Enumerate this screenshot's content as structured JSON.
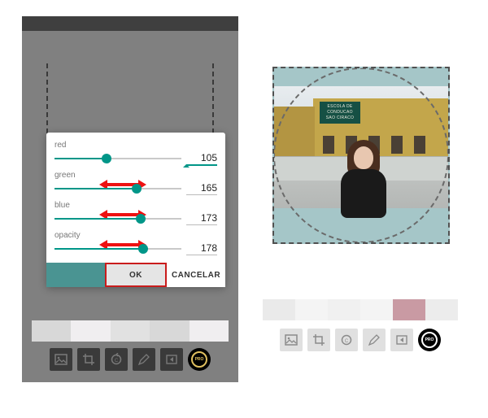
{
  "dialog": {
    "sliders": [
      {
        "label": "red",
        "value": "105",
        "pct": 41
      },
      {
        "label": "green",
        "value": "165",
        "pct": 65
      },
      {
        "label": "blue",
        "value": "173",
        "pct": 68
      },
      {
        "label": "opacity",
        "value": "178",
        "pct": 70
      }
    ],
    "ok_label": "OK",
    "cancel_label": "CANCELAR",
    "swatch_color": "#4a9492"
  },
  "left_toolbar": {
    "icons": [
      "image-icon",
      "crop-icon",
      "rotate-icon",
      "pencil-icon",
      "share-icon",
      "pro-badge"
    ],
    "pro_label": "PRO"
  },
  "right_toolbar": {
    "icons": [
      "image-icon",
      "crop-icon",
      "rotate-icon",
      "pencil-icon",
      "share-icon",
      "pro-badge"
    ],
    "pro_label": "PRO"
  },
  "sign_text": "ESCOLA DE\nCONDUCAO\nSAO CIRACO",
  "colors": {
    "accent": "#009688",
    "highlight": "#c91c1c",
    "overlay_tint": "#a5c6c8"
  }
}
